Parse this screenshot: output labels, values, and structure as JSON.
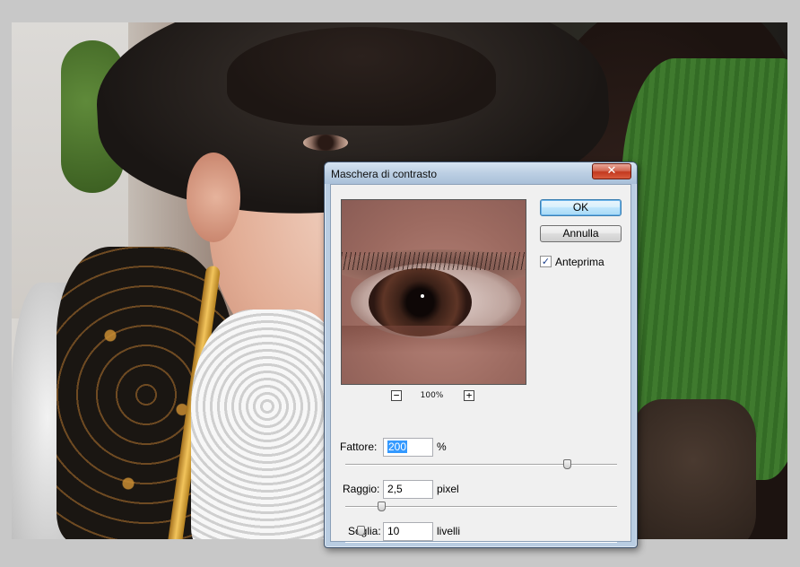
{
  "dialog": {
    "title": "Maschera di contrasto",
    "close_label": "✕",
    "ok_label": "OK",
    "cancel_label": "Annulla",
    "preview_label": "Anteprima",
    "preview_checked": true,
    "preview_check_glyph": "✓",
    "zoom": {
      "out_label": "−",
      "in_label": "+",
      "level": "100%"
    },
    "fields": {
      "amount": {
        "label": "Fattore:",
        "value": "200",
        "unit": "%"
      },
      "radius": {
        "label": "Raggio:",
        "value": "2,5",
        "unit": "pixel"
      },
      "threshold": {
        "label": "Soglia:",
        "value": "10",
        "unit": "livelli"
      }
    }
  },
  "colors": {
    "close_button": "#c3391f",
    "selection": "#3399ff",
    "default_button_border": "#3c7fb1",
    "window_frame": "#b9cde2"
  }
}
